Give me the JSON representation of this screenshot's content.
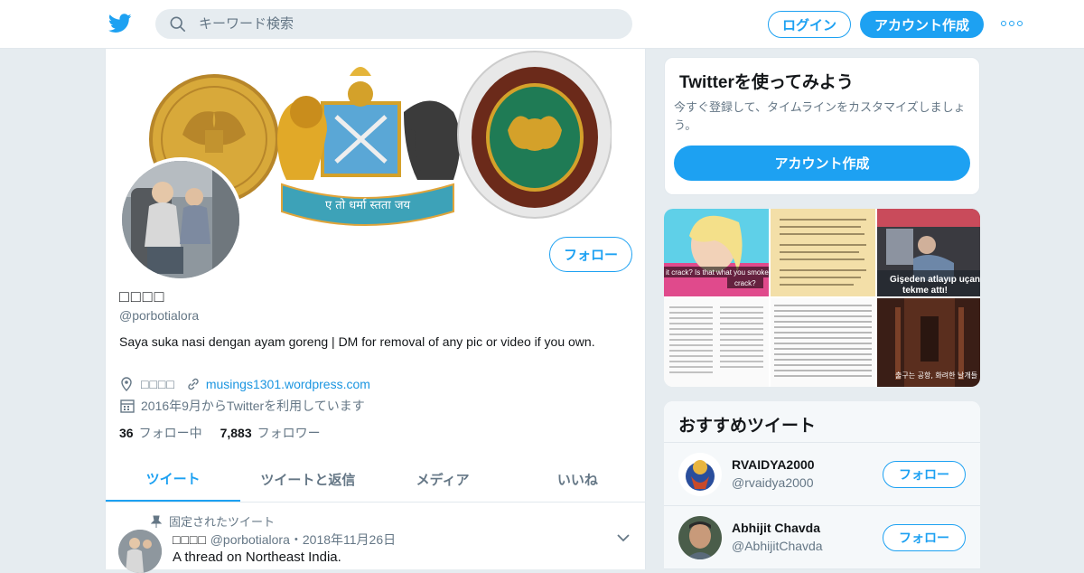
{
  "header": {
    "logo_icon": "twitter-bird-icon",
    "search_placeholder": "キーワード検索",
    "login_label": "ログイン",
    "signup_label": "アカウント作成",
    "more_icon": "more-dots-icon"
  },
  "profile": {
    "name": "□□□□",
    "handle": "@porbotialora",
    "follow_label": "フォロー",
    "bio": "Saya suka nasi dengan ayam goreng | DM for removal of any pic or video if you own.",
    "location": "□□□□",
    "website": "musings1301.wordpress.com",
    "joined": "2016年9月からTwitterを利用しています",
    "following_count": "36",
    "following_label": "フォロー中",
    "followers_count": "7,883",
    "followers_label": "フォロワー",
    "banner_motto": "ए तो धर्मा स्तता जय"
  },
  "tabs": [
    {
      "label": "ツイート"
    },
    {
      "label": "ツイートと返信"
    },
    {
      "label": "メディア"
    },
    {
      "label": "いいね"
    }
  ],
  "pinned_tweet": {
    "pinned_label": "固定されたツイート",
    "name": "□□□□",
    "handle_date": "@porbotialora・2018年11月26日",
    "text": "A thread on Northeast India."
  },
  "sidebar": {
    "try_title": "Twitterを使ってみよう",
    "try_text": "今すぐ登録して、タイムラインをカスタマイズしましょう。",
    "try_button": "アカウント作成",
    "media_captions": {
      "barbie": "it crack? Is that what you smoke? You smo",
      "barbie2": "crack?",
      "gise1": "Gişeden atlayıp uçan",
      "gise2": "tekme attı!",
      "korean": "출구는 공항, 화려한 날개들"
    },
    "rec_title": "おすすめツイート",
    "recommended": [
      {
        "name": "RVAIDYA2000",
        "handle": "@rvaidya2000",
        "follow_label": "フォロー"
      },
      {
        "name": "Abhijit Chavda",
        "handle": "@AbhijitChavda",
        "follow_label": "フォロー"
      }
    ]
  },
  "colors": {
    "accent": "#1da1f2",
    "muted": "#657786",
    "background": "#e6ecf0"
  }
}
